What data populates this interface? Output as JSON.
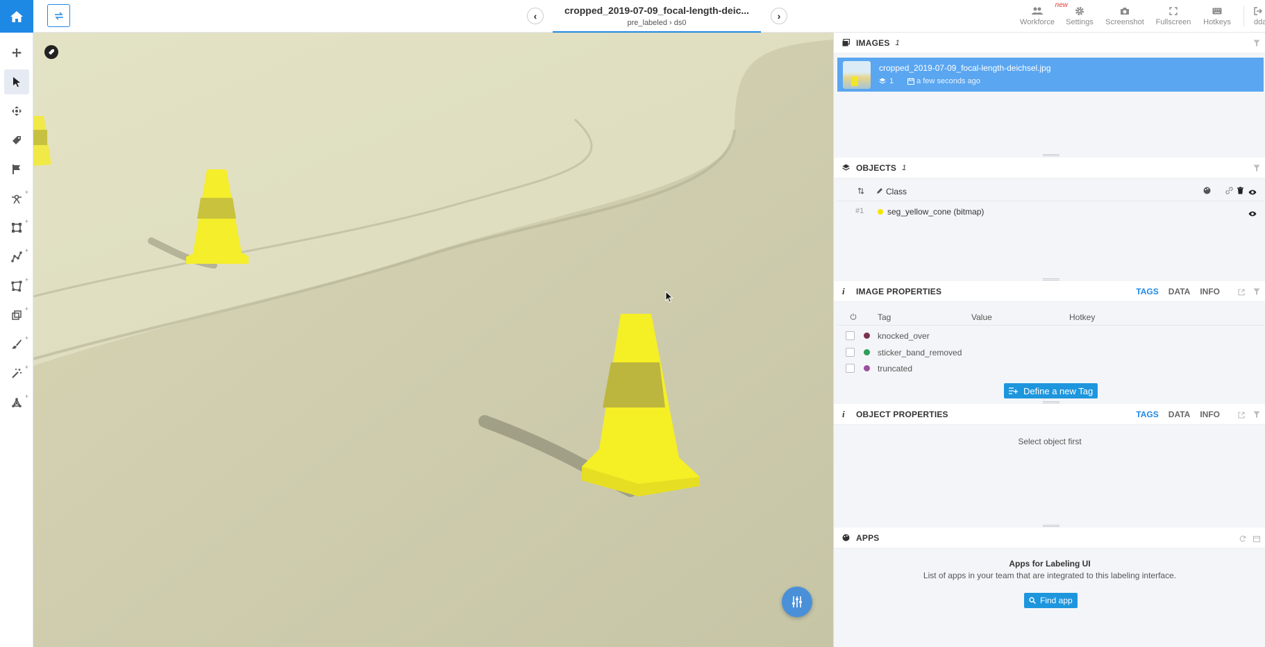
{
  "header": {
    "title": "cropped_2019-07-09_focal-length-deic...",
    "breadcrumb": "pre_labeled › ds0",
    "buttons": [
      {
        "label": "Workforce",
        "icon": "users-icon",
        "badge": "new"
      },
      {
        "label": "Settings",
        "icon": "gear-icon"
      },
      {
        "label": "Screenshot",
        "icon": "camera-icon"
      },
      {
        "label": "Fullscreen",
        "icon": "fullscreen-icon"
      },
      {
        "label": "Hotkeys",
        "icon": "keyboard-icon"
      },
      {
        "label": "dda",
        "icon": "logout-icon"
      }
    ]
  },
  "toolbar": {
    "tools": [
      "move-icon",
      "pointer-icon",
      "drag-icon",
      "tag-icon",
      "flag-icon",
      "point-icon",
      "rectangle-icon",
      "polyline-icon",
      "polygon-icon",
      "cuboid-icon",
      "brush-icon",
      "magic-wand-icon",
      "graph-icon"
    ]
  },
  "images": {
    "title": "IMAGES",
    "count": "1",
    "items": [
      {
        "name": "cropped_2019-07-09_focal-length-deichsel.jpg",
        "objects": "1",
        "time": "a few seconds ago"
      }
    ]
  },
  "objects": {
    "title": "OBJECTS",
    "count": "1",
    "column_class": "Class",
    "items": [
      {
        "index": "#1",
        "label": "seg_yellow_cone (bitmap)",
        "color": "#f3e600"
      }
    ]
  },
  "image_properties": {
    "title": "IMAGE PROPERTIES",
    "tabs": [
      "TAGS",
      "DATA",
      "INFO"
    ],
    "columns": {
      "tag": "Tag",
      "value": "Value",
      "hotkey": "Hotkey"
    },
    "tags": [
      {
        "name": "knocked_over",
        "color": "#7b3152"
      },
      {
        "name": "sticker_band_removed",
        "color": "#2e9e58"
      },
      {
        "name": "truncated",
        "color": "#9b4ea0"
      }
    ],
    "define_button": "Define a new Tag"
  },
  "object_properties": {
    "title": "OBJECT PROPERTIES",
    "tabs": [
      "TAGS",
      "DATA",
      "INFO"
    ],
    "empty_text": "Select object first"
  },
  "apps": {
    "title": "APPS",
    "heading": "Apps for Labeling UI",
    "description": "List of apps in your team that are integrated to this labeling interface.",
    "find_button": "Find app"
  }
}
